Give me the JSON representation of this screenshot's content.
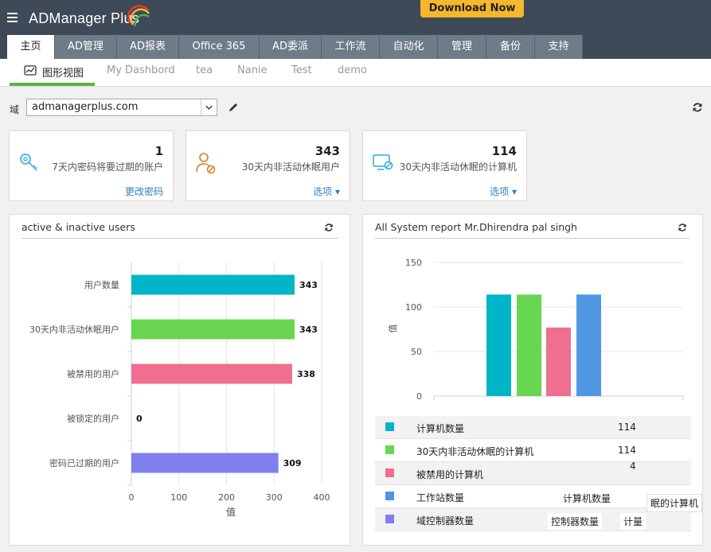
{
  "app": {
    "logo_text": "ADManager Plus",
    "download_label": "Download Now"
  },
  "tabs": [
    "主页",
    "AD管理",
    "AD报表",
    "Office 365",
    "AD委派",
    "工作流",
    "自动化",
    "管理",
    "备份",
    "支持"
  ],
  "subtabs": [
    "图形视图",
    "My Dashbord",
    "tea",
    "Nanie",
    "Test",
    "demo"
  ],
  "domain": {
    "label": "域",
    "value": "admanagerplus.com"
  },
  "cards": [
    {
      "count": "1",
      "desc": "7天内密码将要过期的账户",
      "link": "更改密码",
      "icon": "key-icon"
    },
    {
      "count": "343",
      "desc": "30天内非活动休眠用户",
      "link": "选项",
      "icon": "user-disabled-icon"
    },
    {
      "count": "114",
      "desc": "30天内非活动休眠的计算机",
      "link": "选项",
      "icon": "computer-disabled-icon"
    }
  ],
  "panel_left": {
    "title": "active & inactive users"
  },
  "panel_right": {
    "title": "All System report Mr.Dhirendra pal singh"
  },
  "chart_data": [
    {
      "type": "bar",
      "orientation": "horizontal",
      "title": "active & inactive users",
      "categories": [
        "用户数量",
        "30天内非活动休眠用户",
        "被禁用的用户",
        "被锁定的用户",
        "密码已过期的用户"
      ],
      "values": [
        343,
        343,
        338,
        0,
        309
      ],
      "colors": [
        "#00b5c8",
        "#68d651",
        "#f06e8f",
        "#d9b8ff",
        "#7f7fef"
      ],
      "xlabel": "值",
      "xlim": [
        0,
        400
      ],
      "xticks": [
        0,
        100,
        200,
        300,
        400
      ]
    },
    {
      "type": "bar",
      "title": "All System report Mr.Dhirendra pal singh",
      "categories": [
        "计算机数量",
        "30天内非活动休眠的计算机",
        "被禁用的计算机",
        "工作站数量"
      ],
      "values": [
        114,
        114,
        77,
        114
      ],
      "colors": [
        "#00b5c8",
        "#68d651",
        "#f06e8f",
        "#4f97e3"
      ],
      "ylabel": "值",
      "ylim": [
        0,
        150
      ],
      "yticks": [
        0,
        50,
        100,
        150
      ]
    }
  ],
  "legend_right": [
    {
      "name": "计算机数量",
      "value": "114",
      "color": "#00b5c8"
    },
    {
      "name": "30天内非活动休眠的计算机",
      "value": "114",
      "color": "#68d651"
    },
    {
      "name": "被禁用的计算机",
      "value": "4",
      "color": "#f06e8f"
    },
    {
      "name": "工作站数量",
      "value": "",
      "color": "#4f97e3"
    },
    {
      "name": "域控制器数量",
      "value": "",
      "color": "#7f7fef"
    }
  ],
  "tooltips": [
    "计算机数量",
    "眠的计算机",
    "控制器数量",
    "计量"
  ]
}
